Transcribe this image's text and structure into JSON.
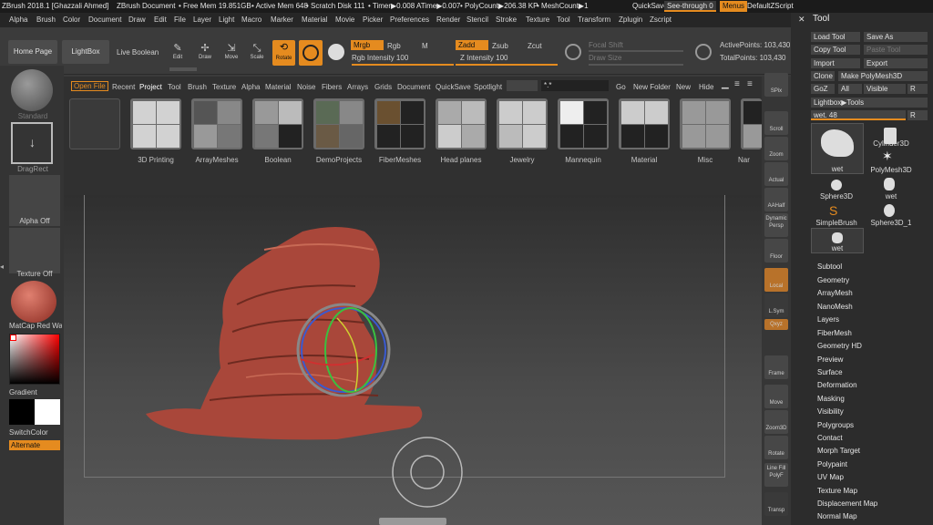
{
  "titlebar": {
    "app": "ZBrush 2018.1 [Ghazzali Ahmed]",
    "doc": "ZBrush Document",
    "freemem": "• Free Mem 19.851GB",
    "activemem": "• Active Mem 648",
    "scratch": "• Scratch Disk 111",
    "timer": "• Timer▶0.008 ATime▶0.007",
    "polycount": "• PolyCount▶206.38 KP",
    "meshcount": "• MeshCount▶1",
    "quicksave": "QuickSave",
    "seethrough": "See-through  0",
    "menus": "Menus",
    "defaultscript": "DefaultZScript"
  },
  "menubar": [
    "Alpha",
    "Brush",
    "Color",
    "Document",
    "Draw",
    "Edit",
    "File",
    "Layer",
    "Light",
    "Macro",
    "Marker",
    "Material",
    "Movie",
    "Picker",
    "Preferences",
    "Render",
    "Stencil",
    "Stroke",
    "Texture",
    "Tool",
    "Transform",
    "Zplugin",
    "Zscript"
  ],
  "topshelf": {
    "home": "Home Page",
    "lightbox": "LightBox",
    "liveboolean": "Live Boolean",
    "edit": "Edit",
    "draw": "Draw",
    "move": "Move",
    "scale": "Scale",
    "rotate": "Rotate",
    "mrgb": "Mrgb",
    "rgb": "Rgb",
    "m": "M",
    "rgb_intensity": "Rgb Intensity 100",
    "zadd": "Zadd",
    "zsub": "Zsub",
    "zcut": "Zcut",
    "z_intensity": "Z Intensity 100",
    "focal_shift": "Focal Shift",
    "draw_size": "Draw Size",
    "active_points": "ActivePoints: 103,430",
    "total_points": "TotalPoints: 103,430"
  },
  "leftshelf": {
    "brush": "Standard",
    "stroke": "DragRect",
    "alpha": "Alpha Off",
    "texture": "Texture Off",
    "material": "MatCap Red Wax",
    "gradient": "Gradient",
    "switchcolor": "SwitchColor",
    "alternate": "Alternate"
  },
  "lightbox": {
    "tabs": [
      "Open File",
      "Recent",
      "Project",
      "Tool",
      "Brush",
      "Texture",
      "Alpha",
      "Material",
      "Noise",
      "Fibers",
      "Arrays",
      "Grids",
      "Document",
      "QuickSave",
      "Spotlight"
    ],
    "search": "*.*",
    "go": "Go",
    "new_folder": "New Folder",
    "new": "New",
    "hide": "Hide",
    "folders": [
      "",
      "3D Printing",
      "ArrayMeshes",
      "Boolean",
      "DemoProjects",
      "FiberMeshes",
      "Head planes",
      "Jewelry",
      "Mannequin",
      "Material",
      "Misc",
      "Nar"
    ]
  },
  "rightshelf": [
    "SPix",
    "Scroll",
    "Zoom",
    "Actual",
    "AAHalf",
    "Dynamic Persp",
    "Floor",
    "Local",
    "L.Sym",
    "Qxyz",
    "Frame",
    "Move",
    "Zoom3D",
    "Rotate",
    "Line Fill PolyF",
    "Transp"
  ],
  "tray": {
    "title": "Tool",
    "load_tool": "Load Tool",
    "save_as": "Save As",
    "copy_tool": "Copy Tool",
    "paste_tool": "Paste Tool",
    "import": "Import",
    "export": "Export",
    "clone": "Clone",
    "make_polymesh": "Make PolyMesh3D",
    "goz": "GoZ",
    "all": "All",
    "visible": "Visible",
    "r": "R",
    "lightbox_tools": "Lightbox▶Tools",
    "wet_slider": "wet. 48",
    "r2": "R",
    "tools": [
      "wet",
      "Cylinder3D",
      "PolyMesh3D",
      "Sphere3D",
      "wet",
      "SimpleBrush",
      "Sphere3D_1",
      "wet"
    ],
    "subpalettes": [
      "Subtool",
      "Geometry",
      "ArrayMesh",
      "NanoMesh",
      "Layers",
      "FiberMesh",
      "Geometry HD",
      "Preview",
      "Surface",
      "Deformation",
      "Masking",
      "Visibility",
      "Polygroups",
      "Contact",
      "Morph Target",
      "Polypaint",
      "UV Map",
      "Texture Map",
      "Displacement Map",
      "Normal Map"
    ]
  },
  "colors": {
    "accent": "#e58b1f",
    "wax": "#b14a3a"
  }
}
